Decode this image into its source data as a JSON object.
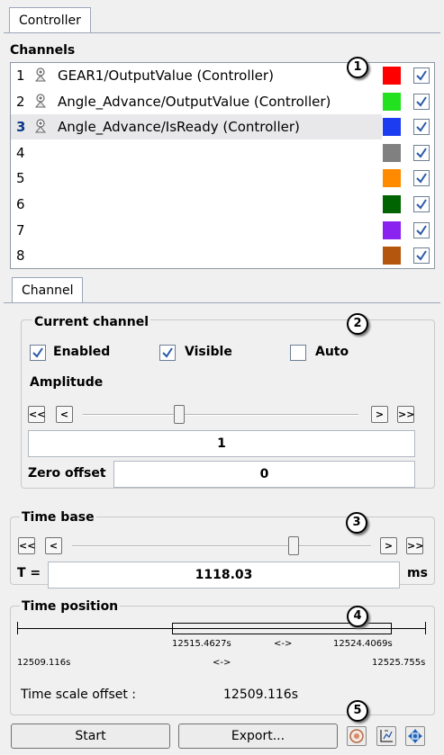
{
  "tabs": {
    "controller": "Controller",
    "channel": "Channel"
  },
  "channels": {
    "heading": "Channels",
    "rows": [
      {
        "num": "1",
        "label": "GEAR1/OutputValue (Controller)",
        "color": "#ff0000",
        "checked": true
      },
      {
        "num": "2",
        "label": "Angle_Advance/OutputValue (Controller)",
        "color": "#22e11e",
        "checked": true
      },
      {
        "num": "3",
        "label": "Angle_Advance/IsReady (Controller)",
        "color": "#1b3cf0",
        "checked": true,
        "selected": true
      },
      {
        "num": "4",
        "label": "",
        "color": "#808080",
        "checked": true
      },
      {
        "num": "5",
        "label": "",
        "color": "#ff8a00",
        "checked": true
      },
      {
        "num": "6",
        "label": "",
        "color": "#006400",
        "checked": true
      },
      {
        "num": "7",
        "label": "",
        "color": "#8a22f0",
        "checked": true
      },
      {
        "num": "8",
        "label": "",
        "color": "#b4560e",
        "checked": true
      }
    ]
  },
  "current_channel": {
    "title": "Current channel",
    "enabled_label": "Enabled",
    "visible_label": "Visible",
    "auto_label": "Auto",
    "enabled": true,
    "visible": true,
    "auto": false,
    "amplitude_label": "Amplitude",
    "amplitude_value": "1",
    "zero_offset_label": "Zero offset",
    "zero_offset_value": "0",
    "slider_level": 0.35
  },
  "time_base": {
    "title": "Time base",
    "t_label": "T =",
    "t_value": "1118.03",
    "unit": "ms",
    "slider_level": 0.74
  },
  "time_position": {
    "title": "Time position",
    "window_start": "12515.4627s",
    "window_end": "12524.4069s",
    "window_arrow": "<->",
    "range_start": "12509.116s",
    "range_end": "12525.755s",
    "range_arrow": "<->",
    "scale_offset_label": "Time scale offset :",
    "scale_offset_value": "12509.116s"
  },
  "buttons": {
    "start": "Start",
    "export": "Export..."
  },
  "step_buttons": {
    "first": "<<",
    "prev": "<",
    "next": ">",
    "last": ">>"
  },
  "callouts": [
    "1",
    "2",
    "3",
    "4",
    "5"
  ],
  "icons": [
    "record-icon",
    "axes-icon",
    "move-icon"
  ]
}
